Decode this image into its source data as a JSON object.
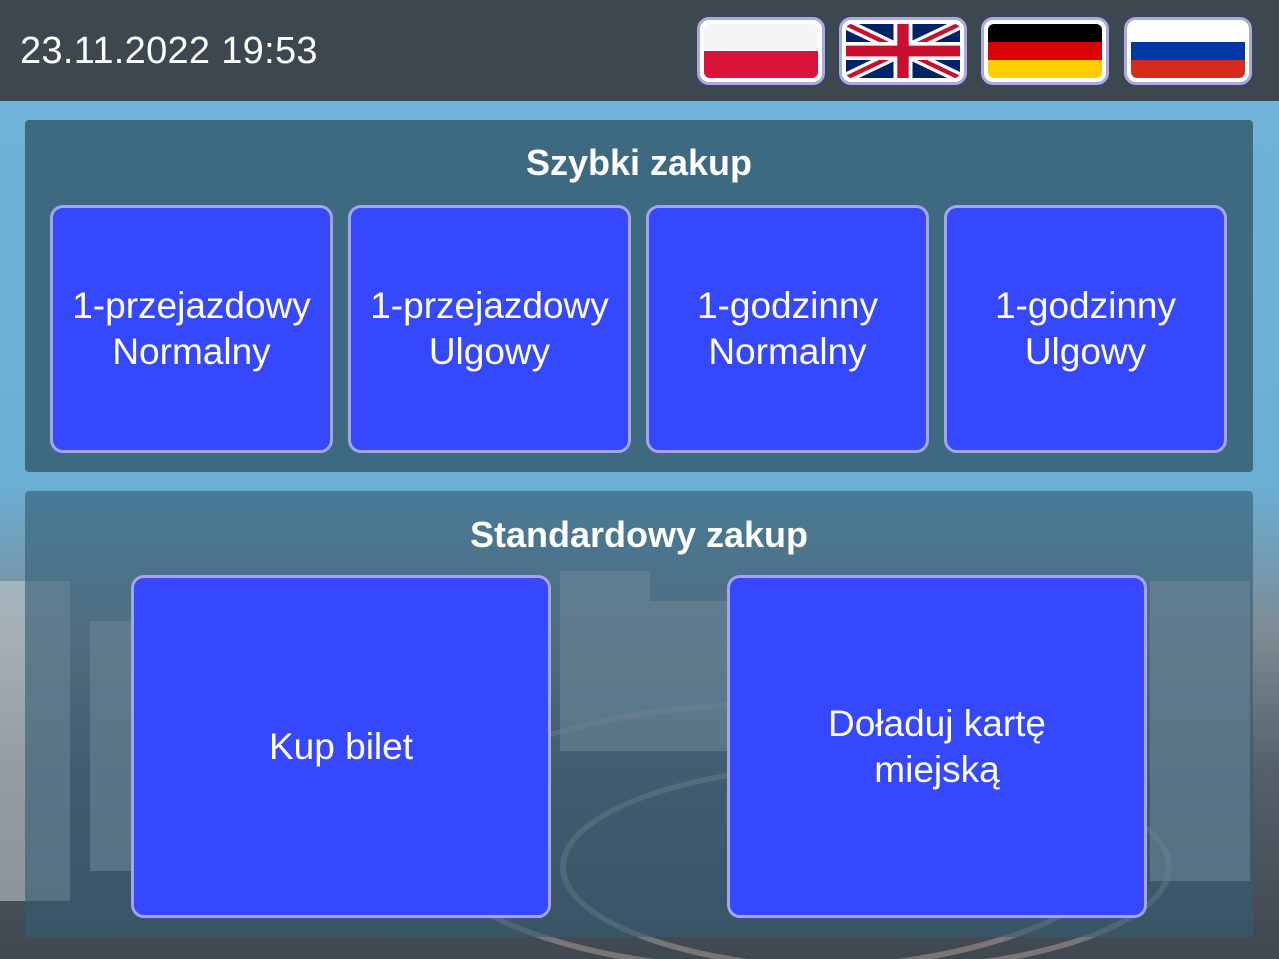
{
  "header": {
    "datetime": "23.11.2022 19:53",
    "languages": [
      {
        "code": "pl",
        "icon": "poland-flag-icon"
      },
      {
        "code": "en",
        "icon": "uk-flag-icon"
      },
      {
        "code": "de",
        "icon": "germany-flag-icon"
      },
      {
        "code": "ru",
        "icon": "russia-flag-icon"
      }
    ]
  },
  "quick_purchase": {
    "title": "Szybki zakup",
    "buttons": [
      {
        "line1": "1-przejazdowy",
        "line2": "Normalny"
      },
      {
        "line1": "1-przejazdowy",
        "line2": "Ulgowy"
      },
      {
        "line1": "1-godzinny",
        "line2": "Normalny"
      },
      {
        "line1": "1-godzinny",
        "line2": "Ulgowy"
      }
    ]
  },
  "standard_purchase": {
    "title": "Standardowy zakup",
    "buy_ticket": {
      "line1": "Kup bilet"
    },
    "top_up_card": {
      "line1": "Doładuj kartę",
      "line2": "miejską"
    }
  },
  "colors": {
    "header_bg": "#3c474f",
    "button_bg": "#3548fd",
    "button_border": "#a3a6ec",
    "panel_bg": "#3e6a81"
  }
}
